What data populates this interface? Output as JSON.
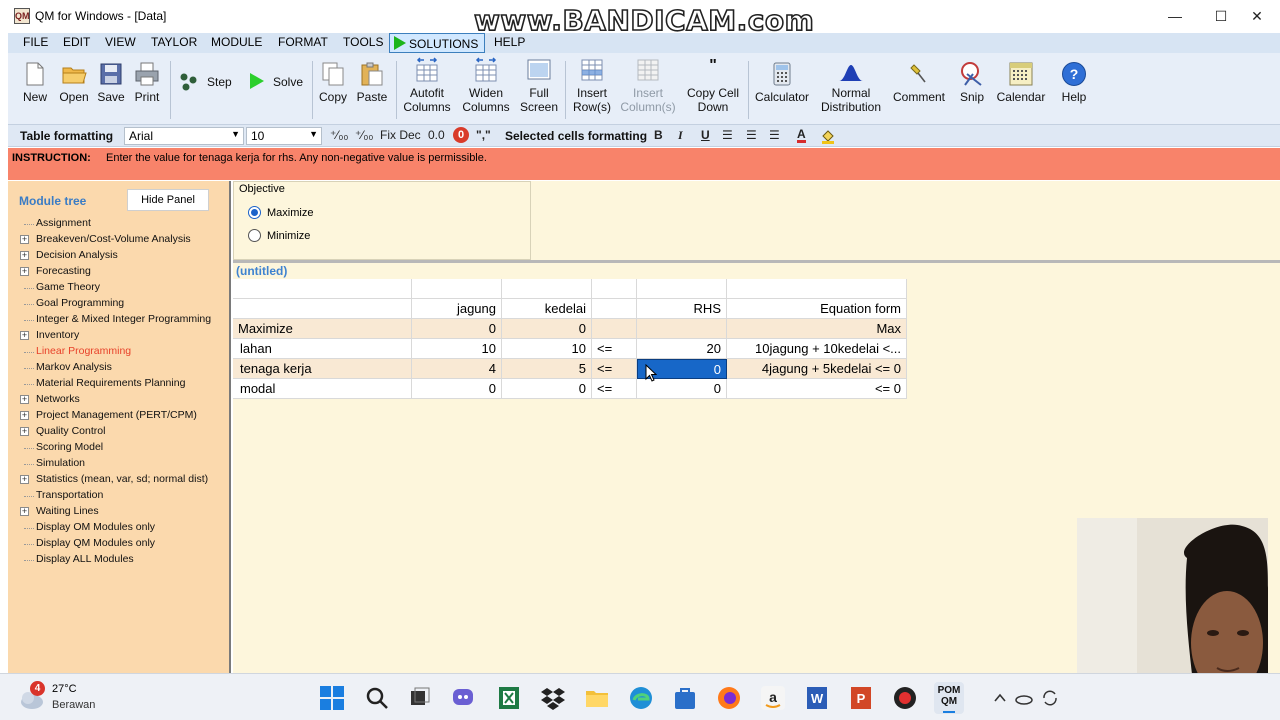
{
  "window": {
    "title": "QM for Windows - [Data]",
    "app_icon_text": "QM",
    "watermark": "www.BANDICAM.com",
    "controls": {
      "minimize": "—",
      "maximize": "☐",
      "close": "✕"
    }
  },
  "menu": {
    "items": [
      "FILE",
      "EDIT",
      "VIEW",
      "TAYLOR",
      "MODULE",
      "FORMAT",
      "TOOLS",
      "SOLUTIONS",
      "HELP"
    ]
  },
  "toolbar": {
    "new": "New",
    "open": "Open",
    "save": "Save",
    "print": "Print",
    "step": "Step",
    "solve": "Solve",
    "copy": "Copy",
    "paste": "Paste",
    "autofit_1": "Autofit",
    "autofit_2": "Columns",
    "widen_1": "Widen",
    "widen_2": "Columns",
    "full_1": "Full",
    "full_2": "Screen",
    "insert_row_1": "Insert",
    "insert_row_2": "Row(s)",
    "insert_col_1": "Insert",
    "insert_col_2": "Column(s)",
    "copy_cell_1": "Copy Cell",
    "copy_cell_2": "Down",
    "copy_cell_icon": "\"",
    "calculator": "Calculator",
    "normal_1": "Normal",
    "normal_2": "Distribution",
    "comment": "Comment",
    "snip": "Snip",
    "calendar": "Calendar",
    "help": "Help"
  },
  "formatbar": {
    "table_formatting": "Table formatting",
    "font": "Arial",
    "size": "10",
    "fix_dec": "Fix Dec",
    "decimal": "0.0",
    "zero": "0",
    "comma": "\",\"",
    "selected_cells": "Selected cells formatting",
    "bold": "B",
    "italic": "I",
    "underline": "U",
    "font_color": "A"
  },
  "instruction": {
    "label": "INSTRUCTION:",
    "text": "Enter the value for  tenaga kerja for rhs. Any non-negative value is permissible."
  },
  "module_tree": {
    "title": "Module tree",
    "hide_button": "Hide Panel",
    "items": [
      "Assignment",
      "Breakeven/Cost-Volume Analysis",
      "Decision Analysis",
      "Forecasting",
      "Game Theory",
      "Goal Programming",
      "Integer & Mixed Integer Programming",
      "Inventory",
      "Linear Programming",
      "Markov Analysis",
      "Material Requirements Planning",
      "Networks",
      "Project Management (PERT/CPM)",
      "Quality Control",
      "Scoring Model",
      "Simulation",
      "Statistics (mean, var, sd; normal dist)",
      "Transportation",
      "Waiting Lines",
      "Display OM Modules only",
      "Display QM Modules only",
      "Display ALL Modules"
    ],
    "selected": "Linear Programming"
  },
  "objective": {
    "legend": "Objective",
    "maximize": "Maximize",
    "minimize": "Minimize",
    "selected": "Maximize"
  },
  "problem": {
    "title": "(untitled)",
    "headers": [
      "",
      "jagung",
      "kedelai",
      "",
      "RHS",
      "Equation form"
    ],
    "rows": [
      [
        "Maximize",
        "0",
        "0",
        "",
        "",
        "Max"
      ],
      [
        "lahan",
        "10",
        "10",
        "<=",
        "20",
        "10jagung +  10kedelai <..."
      ],
      [
        "tenaga kerja",
        "4",
        "5",
        "<=",
        "0",
        "4jagung +  5kedelai <= 0"
      ],
      [
        "modal",
        "0",
        "0",
        "<=",
        "0",
        "<= 0"
      ]
    ]
  },
  "taskbar": {
    "weather_badge": "4",
    "temperature": "27°C",
    "condition": "Berawan",
    "pom_qm_1": "POM",
    "pom_qm_2": "QM"
  }
}
